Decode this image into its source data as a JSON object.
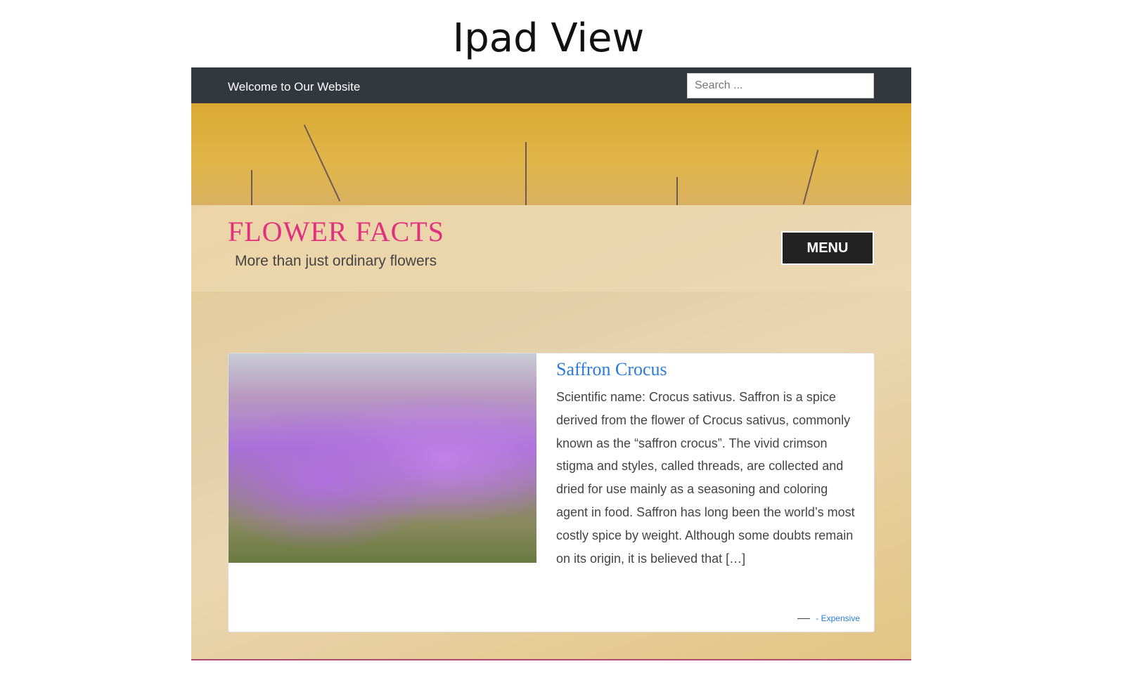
{
  "page_title": "Ipad View",
  "topbar": {
    "welcome": "Welcome to Our Website",
    "search_placeholder": "Search ..."
  },
  "site": {
    "title": "FLOWER FACTS",
    "tagline": "More than just ordinary flowers",
    "menu_label": "MENU"
  },
  "post": {
    "title": "Saffron Crocus",
    "excerpt": "Scientific name: Crocus sativus. Saffron is a spice derived from the flower of Crocus sativus, commonly known as the “saffron crocus”. The vivid crimson stigma and styles, called threads, are collected and dried for use mainly as a seasoning and coloring agent in food. Saffron has long been the world’s most costly spice by weight. Although some doubts remain on its origin, it is believed that […]",
    "category": "- Expensive"
  }
}
